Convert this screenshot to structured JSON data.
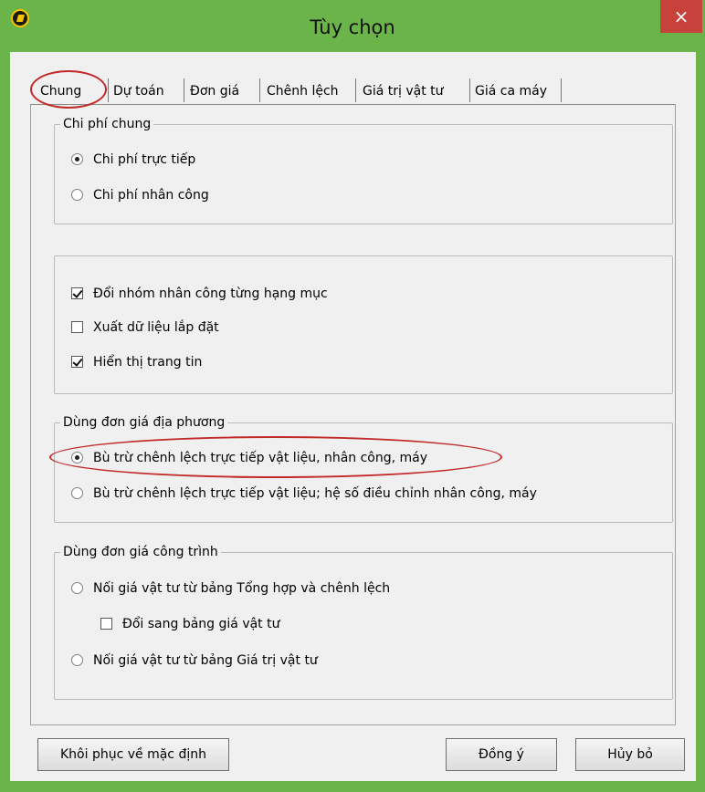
{
  "window": {
    "title": "Tùy chọn",
    "close_glyph": "×"
  },
  "tabs": [
    {
      "label": "Chung"
    },
    {
      "label": "Dự toán"
    },
    {
      "label": "Đơn giá"
    },
    {
      "label": "Chênh lệch"
    },
    {
      "label": "Giá trị vật tư"
    },
    {
      "label": "Giá ca máy"
    }
  ],
  "groups": {
    "chi_phi_chung": {
      "title": "Chi phí chung",
      "options": [
        {
          "label": "Chi phí trực tiếp",
          "checked": true
        },
        {
          "label": "Chi phí nhân công",
          "checked": false
        }
      ]
    },
    "misc": {
      "options": [
        {
          "label": "Đổi nhóm nhân công từng hạng mục",
          "checked": true
        },
        {
          "label": "Xuất dữ liệu lắp đặt",
          "checked": false
        },
        {
          "label": "Hiển thị trang tin",
          "checked": true
        }
      ]
    },
    "dia_phuong": {
      "title": "Dùng đơn giá địa phương",
      "options": [
        {
          "label": "Bù trừ chênh lệch trực tiếp vật liệu, nhân công, máy",
          "checked": true
        },
        {
          "label": "Bù trừ chênh lệch trực tiếp vật liệu; hệ số điều chỉnh nhân công, máy",
          "checked": false
        }
      ]
    },
    "cong_trinh": {
      "title": "Dùng đơn giá công trình",
      "options": [
        {
          "label": "Nối giá vật tư từ bảng Tổng hợp và chênh lệch",
          "checked": false
        },
        {
          "label": "Đổi sang bảng giá vật tư",
          "checked": false
        },
        {
          "label": "Nối giá vật tư từ bảng Giá trị vật tư",
          "checked": false
        }
      ]
    }
  },
  "buttons": {
    "restore": "Khôi phục về mặc định",
    "ok": "Đồng ý",
    "cancel": "Hủy bỏ"
  },
  "colors": {
    "titlebar": "#6bb44a",
    "close": "#c7423a",
    "annotation": "#c22a2a"
  }
}
